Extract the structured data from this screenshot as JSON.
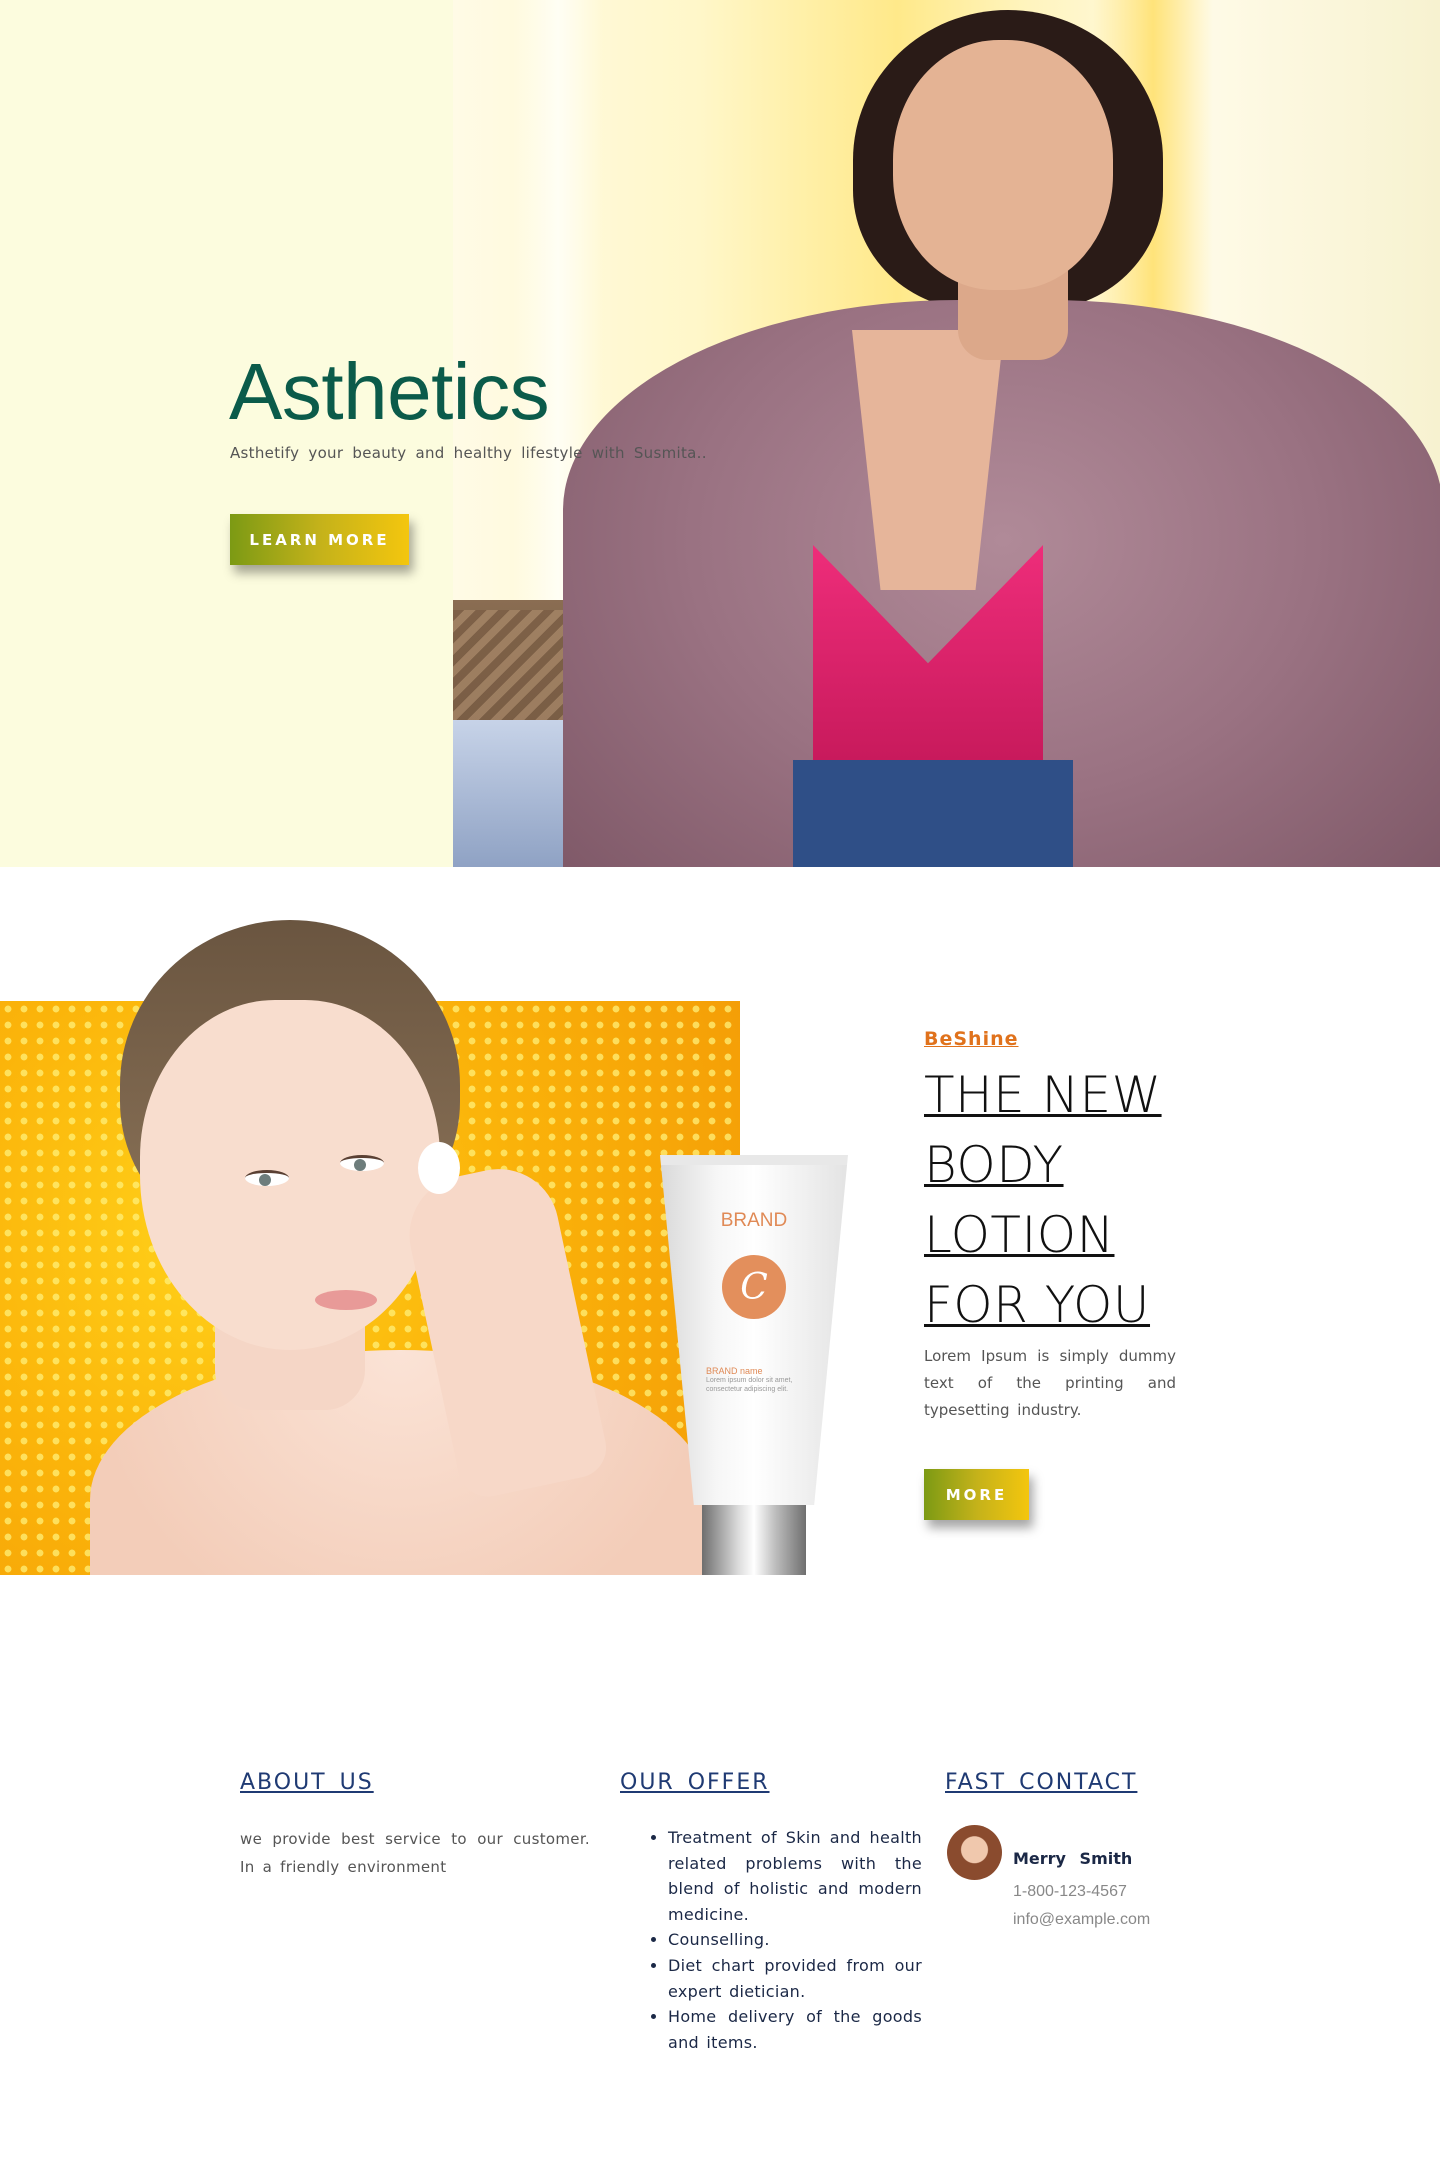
{
  "hero": {
    "title": "Asthetics",
    "subtitle": "Asthetify your beauty and healthy lifestyle with Susmita..",
    "button_label": "LEARN MORE"
  },
  "promo": {
    "brand": "BeShine",
    "title": "THE NEW BODY LOTION FOR YOU",
    "description": "Lorem Ipsum is simply dummy text of the printing and typesetting industry.",
    "button_label": "MORE",
    "tube": {
      "brand": "BRAND",
      "logo_letter": "C",
      "name": "BRAND name",
      "fine_print": "Lorem ipsum dolor sit amet, consectetur adipiscing elit."
    }
  },
  "footer": {
    "about": {
      "title": "ABOUT US",
      "text": "we provide best service to our customer. In a friendly environment"
    },
    "offer": {
      "title": "OUR OFFER",
      "items": [
        " Treatment of Skin and health related problems with the blend of holistic and modern medicine.",
        "Counselling.",
        "Diet chart provided from our expert dietician.",
        " Home delivery of the goods and items."
      ]
    },
    "contact": {
      "title": "FAST CONTACT",
      "name": "Merry Smith",
      "phone": "1-800-123-4567",
      "email": "info@example.com"
    }
  },
  "colors": {
    "hero_bg": "#fcfcde",
    "title_green": "#0b5b4a",
    "button_gradient_start": "#7c9a14",
    "button_gradient_end": "#f4c60e",
    "brand_orange": "#e0721c",
    "footer_navy": "#1f3a73"
  }
}
